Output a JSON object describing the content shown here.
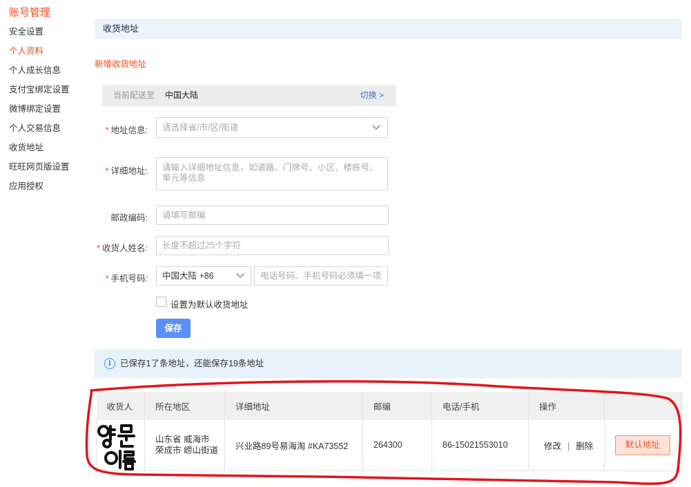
{
  "sidebar": {
    "title": "账号管理",
    "items": [
      {
        "label": "安全设置",
        "active": false
      },
      {
        "label": "个人资料",
        "active": true
      },
      {
        "label": "个人成长信息",
        "active": false
      },
      {
        "label": "支付宝绑定设置",
        "active": false
      },
      {
        "label": "微博绑定设置",
        "active": false
      },
      {
        "label": "个人交易信息",
        "active": false
      },
      {
        "label": "收货地址",
        "active": false
      },
      {
        "label": "旺旺网页版设置",
        "active": false
      },
      {
        "label": "应用授权",
        "active": false
      }
    ]
  },
  "header": {
    "title": "收货地址"
  },
  "form": {
    "add_title": "新增收货地址",
    "region_bar": {
      "label": "当前配送至",
      "value": "中国大陆",
      "switch": "切换 >"
    },
    "address": {
      "label": "地址信息:",
      "placeholder": "请选择省/市/区/街道"
    },
    "detail": {
      "label": "详细地址:",
      "placeholder": "请输入详细地址信息，如道路、门牌号、小区、楼栋号、单元等信息"
    },
    "postcode": {
      "label": "邮政编码:",
      "placeholder": "请填写邮编"
    },
    "name": {
      "label": "收货人姓名:",
      "placeholder": "长度不超过25个字符"
    },
    "phone": {
      "label": "手机号码:",
      "country": "中国大陆 +86",
      "placeholder": "电话号码、手机号码必须填一项"
    },
    "default_checkbox": "设置为默认收货地址",
    "save": "保存"
  },
  "info": {
    "icon": "info-icon",
    "text": "已保存1了条地址，还能保存19条地址"
  },
  "table": {
    "headers": [
      "收货人",
      "所在地区",
      "详细地址",
      "邮编",
      "电话/手机",
      "操作",
      ""
    ],
    "rows": [
      {
        "name": "영문 이름",
        "region": "山东省 威海市 荣成市 崂山街道",
        "detail": "兴业路89号易海淘 #KA73552",
        "postcode": "264300",
        "phone": "86-15021553010",
        "edit": "修改",
        "separator": "|",
        "delete": "删除",
        "default": "默认地址"
      }
    ]
  },
  "colors": {
    "accent": "#f04a1c",
    "link": "#3a6fd8",
    "button": "#5b8ff9",
    "annotation": "#e0161c"
  }
}
